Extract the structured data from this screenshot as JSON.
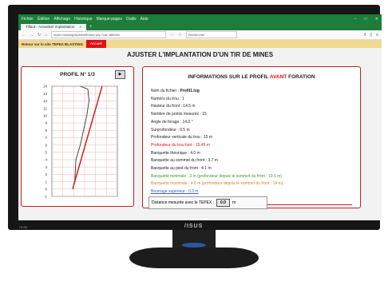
{
  "browser": {
    "menu": [
      "Fichier",
      "Édition",
      "Affichage",
      "Historique",
      "Marque-pages",
      "Outils",
      "Aide"
    ],
    "tab_title": "Tiflard - Actualiser implantation",
    "url": "tepex-blasting/ajustertifinstex.php?var=affichier",
    "search_placeholder": "Rechercher"
  },
  "site": {
    "back_link": "Retour sur le site TEPEX BLASTING",
    "home_button": "Accueil",
    "page_title": "AJUSTER L'IMPLANTATION D'UN TIR DE MINES"
  },
  "profile": {
    "label": "PROFIL N°",
    "number": "1/3",
    "next_symbol": "▶"
  },
  "chart_data": {
    "type": "line",
    "y_ticks": [
      "14",
      "13",
      "12",
      "11",
      "10",
      "9",
      "8",
      "7",
      "6",
      "5",
      "4",
      "3",
      "2",
      "1",
      "0",
      "-1"
    ],
    "ylim": [
      -1,
      14
    ],
    "series": [
      {
        "values": [
          [
            2.6,
            14
          ],
          [
            3.3,
            13.6
          ],
          [
            3.4,
            12.0
          ],
          [
            3.2,
            10.0
          ],
          [
            2.9,
            8.0
          ],
          [
            2.6,
            6.0
          ],
          [
            2.2,
            4.0
          ],
          [
            2.1,
            1.0
          ]
        ],
        "color": "#333333"
      },
      {
        "values": [
          [
            4.6,
            14
          ],
          [
            1.9,
            0
          ]
        ],
        "color": "#d11111"
      }
    ]
  },
  "info": {
    "heading_pre": "INFORMATIONS SUR LE PROFIL",
    "heading_red": "AVANT",
    "heading_post": "FORATION",
    "filename_label": "Nom du fichier :",
    "filename": "Profil1.log",
    "lines": [
      {
        "text": "Numéro du trou : 1",
        "color": "black"
      },
      {
        "text": "Hauteur du front : 14.5 m",
        "color": "black"
      },
      {
        "text": "Nombre de points mesurés : 15",
        "color": "black"
      },
      {
        "text": "Angle de forage : 14.0 °",
        "color": "black"
      },
      {
        "text": "Surprofondeur : 0.5 m",
        "color": "black"
      },
      {
        "text": "Profondeur verticale du trou : 15 m",
        "color": "black"
      },
      {
        "text": "Profondeur du trou foré : 15.45 m",
        "color": "red"
      },
      {
        "text": "Banquette théorique : 4.0 m",
        "color": "black"
      },
      {
        "text": "Banquette au sommet du front : 3.7 m",
        "color": "black"
      },
      {
        "text": "Banquette au pied du front : 4.1 m",
        "color": "black"
      },
      {
        "text": "Banquette minimale : 3 m (profondeur depuis le sommet du front : 10.1 m)",
        "color": "green"
      },
      {
        "text": "Banquette maximale : 4.6 m (profondeur depuis le sommet du front : 14 m)",
        "color": "orange"
      },
      {
        "text": "Bourrage supérieur : 0.3 m",
        "color": "blue"
      }
    ],
    "distance_label": "Distance mesurée avec le TEPEX :",
    "distance_value": "0.0",
    "distance_unit": "m"
  },
  "monitor": {
    "brand": "/ISUS",
    "port_label": "HDMI"
  }
}
